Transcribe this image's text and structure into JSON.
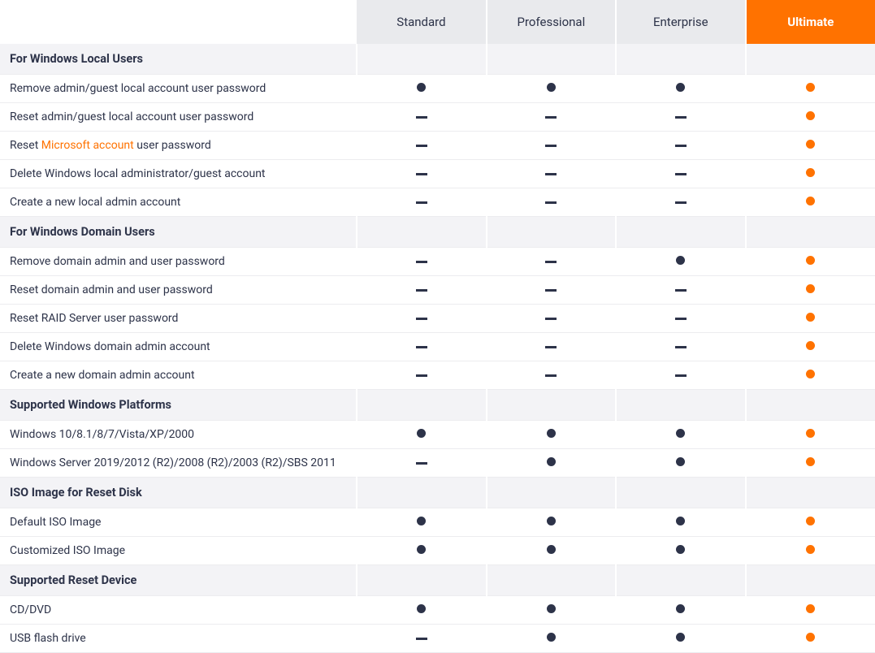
{
  "plans": [
    "Standard",
    "Professional",
    "Enterprise",
    "Ultimate"
  ],
  "highlight_plan_index": 3,
  "sections": [
    {
      "title": "For Windows Local Users",
      "rows": [
        {
          "label": "Remove admin/guest local account user password",
          "marks": [
            "yes",
            "yes",
            "yes",
            "yes"
          ]
        },
        {
          "label": "Reset admin/guest local account user password",
          "marks": [
            "no",
            "no",
            "no",
            "yes"
          ]
        },
        {
          "label_html": "Reset {link}Microsoft account{/link} user password",
          "marks": [
            "no",
            "no",
            "no",
            "yes"
          ]
        },
        {
          "label": "Delete Windows local administrator/guest account",
          "marks": [
            "no",
            "no",
            "no",
            "yes"
          ]
        },
        {
          "label": "Create a new local admin account",
          "marks": [
            "no",
            "no",
            "no",
            "yes"
          ]
        }
      ]
    },
    {
      "title": "For Windows Domain Users",
      "rows": [
        {
          "label": "Remove domain admin and user password",
          "marks": [
            "no",
            "no",
            "yes",
            "yes"
          ]
        },
        {
          "label": "Reset domain admin and user password",
          "marks": [
            "no",
            "no",
            "no",
            "yes"
          ]
        },
        {
          "label": "Reset RAID Server user password",
          "marks": [
            "no",
            "no",
            "no",
            "yes"
          ]
        },
        {
          "label": "Delete Windows domain admin account",
          "marks": [
            "no",
            "no",
            "no",
            "yes"
          ]
        },
        {
          "label": "Create a new domain admin account",
          "marks": [
            "no",
            "no",
            "no",
            "yes"
          ]
        }
      ]
    },
    {
      "title": "Supported Windows Platforms",
      "rows": [
        {
          "label": "Windows 10/8.1/8/7/Vista/XP/2000",
          "marks": [
            "yes",
            "yes",
            "yes",
            "yes"
          ]
        },
        {
          "label": "Windows Server 2019/2012 (R2)/2008 (R2)/2003 (R2)/SBS 2011",
          "marks": [
            "no",
            "yes",
            "yes",
            "yes"
          ]
        }
      ]
    },
    {
      "title": "ISO Image for Reset Disk",
      "rows": [
        {
          "label": "Default ISO Image",
          "marks": [
            "yes",
            "yes",
            "yes",
            "yes"
          ]
        },
        {
          "label": "Customized ISO Image",
          "marks": [
            "yes",
            "yes",
            "yes",
            "yes"
          ]
        }
      ]
    },
    {
      "title": "Supported Reset Device",
      "rows": [
        {
          "label": "CD/DVD",
          "marks": [
            "yes",
            "yes",
            "yes",
            "yes"
          ]
        },
        {
          "label": "USB flash drive",
          "marks": [
            "no",
            "yes",
            "yes",
            "yes"
          ]
        }
      ]
    }
  ]
}
